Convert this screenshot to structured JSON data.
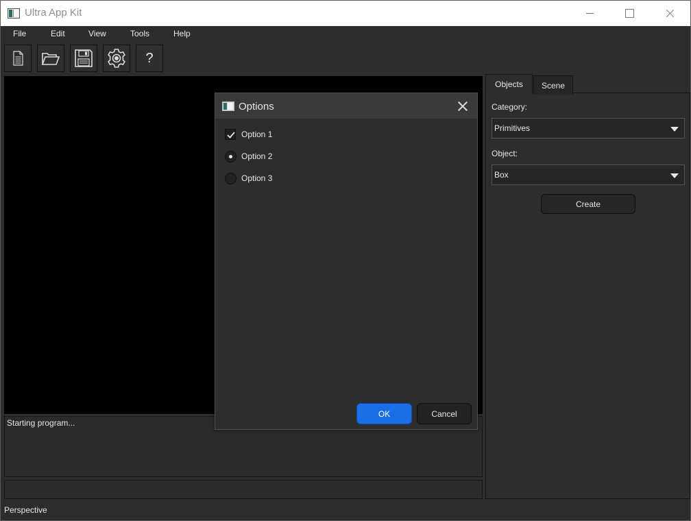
{
  "window": {
    "title": "Ultra App Kit"
  },
  "menu": [
    "File",
    "Edit",
    "View",
    "Tools",
    "Help"
  ],
  "toolbar": {
    "items": [
      {
        "icon": "new-file-icon"
      },
      {
        "icon": "open-folder-icon"
      },
      {
        "icon": "save-icon"
      },
      {
        "icon": "settings-gear-icon"
      },
      {
        "icon": "help-icon",
        "glyph": "?"
      }
    ]
  },
  "console": {
    "text": "Starting program...",
    "input_value": ""
  },
  "statusbar": {
    "text": "Perspective"
  },
  "side_panel": {
    "tabs": [
      {
        "label": "Objects",
        "selected": true
      },
      {
        "label": "Scene",
        "selected": false
      }
    ],
    "category": {
      "label": "Category:",
      "value": "Primitives"
    },
    "object": {
      "label": "Object:",
      "value": "Box"
    },
    "create_label": "Create"
  },
  "dialog": {
    "title": "Options",
    "options": [
      {
        "label": "Option 1",
        "type": "checkbox",
        "checked": true
      },
      {
        "label": "Option 2",
        "type": "radio",
        "checked": true
      },
      {
        "label": "Option 3",
        "type": "radio",
        "checked": false
      }
    ],
    "ok_label": "OK",
    "cancel_label": "Cancel"
  },
  "colors": {
    "background": "#2d2d2d",
    "viewport": "#000000",
    "accent": "#1a6fe6"
  }
}
